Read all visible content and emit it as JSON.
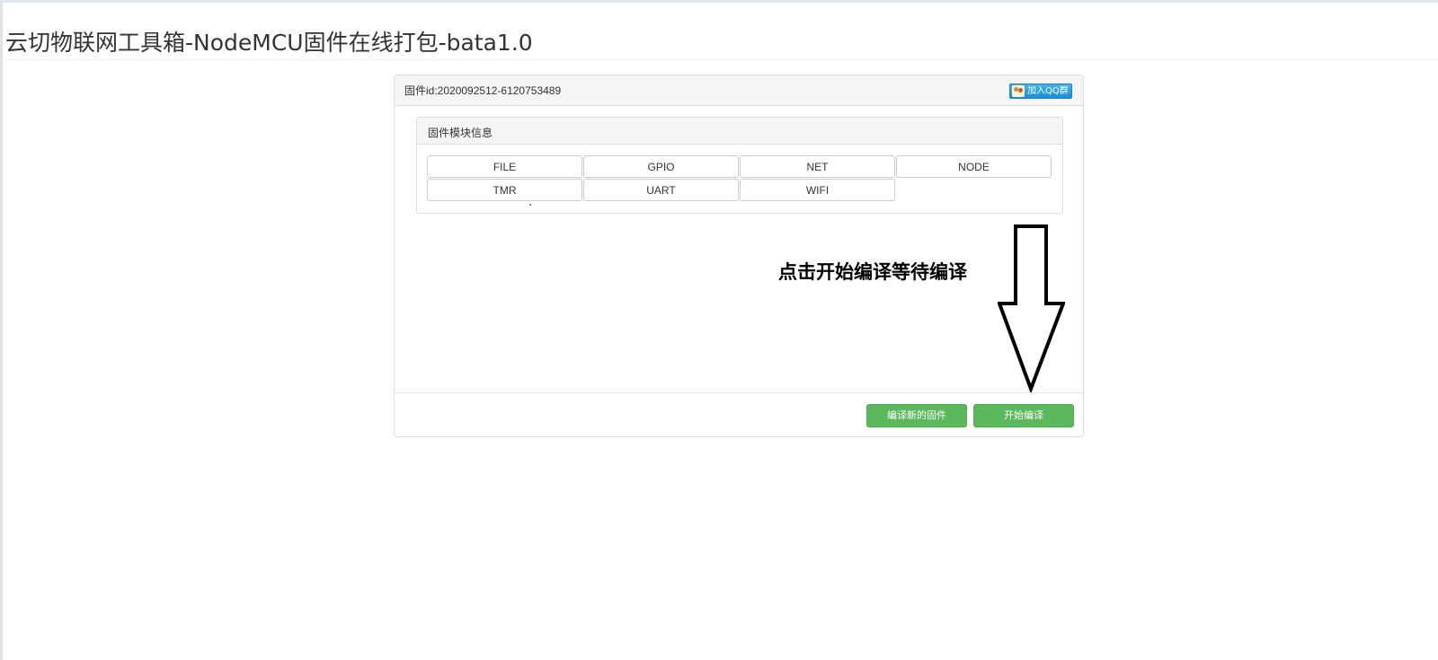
{
  "page": {
    "title": "云切物联网工具箱-NodeMCU固件在线打包-bata1.0"
  },
  "panel": {
    "firmware_id": "固件id:2020092512-6120753489",
    "qq_button_label": "加入QQ群"
  },
  "modules_panel": {
    "title": "固件模块信息",
    "modules": [
      "FILE",
      "GPIO",
      "NET",
      "NODE",
      "TMR",
      "UART",
      "WIFI"
    ]
  },
  "annotation": {
    "text": "点击开始编译等待编译"
  },
  "footer": {
    "compile_new_label": "编译新的固件",
    "start_compile_label": "开始编译"
  },
  "colors": {
    "button_green": "#5cb85c",
    "qq_blue": "#1d8fd6"
  },
  "icons": {
    "qq": "qq-group-icon",
    "arrow": "down-arrow-icon"
  }
}
